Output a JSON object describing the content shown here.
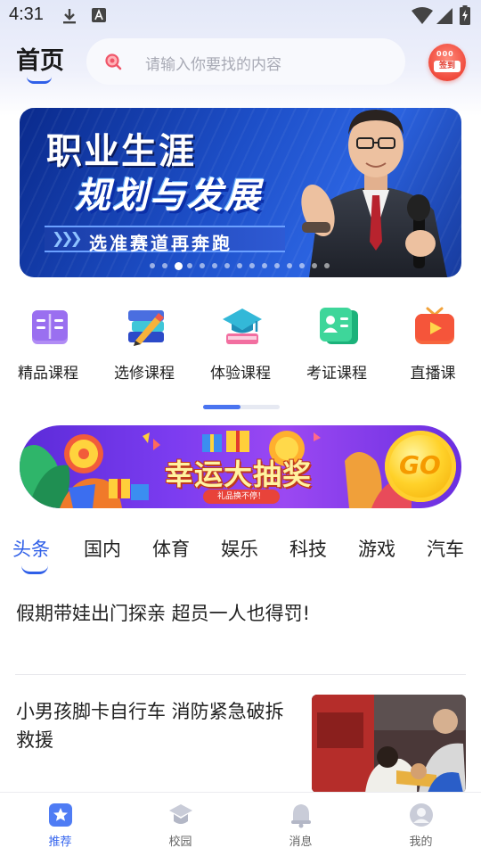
{
  "status_bar": {
    "time": "4:31"
  },
  "header": {
    "title": "首页",
    "search_placeholder": "请输入你要找的内容",
    "checkin": {
      "top_text": "000",
      "label": "签到"
    }
  },
  "banner": {
    "title_line1": "职业生涯",
    "title_line2": "规划与发展",
    "subtitle": "选准赛道再奔跑",
    "dot_count": 15,
    "active_dot": 2
  },
  "categories": [
    {
      "label": "精品课程",
      "icon": "book-open-icon"
    },
    {
      "label": "选修课程",
      "icon": "books-pencil-icon"
    },
    {
      "label": "体验课程",
      "icon": "graduation-cap-icon"
    },
    {
      "label": "考证课程",
      "icon": "id-card-icon"
    },
    {
      "label": "直播课",
      "icon": "tv-play-icon"
    }
  ],
  "promo": {
    "title": "幸运大抽奖",
    "subtitle": "礼品换不停！",
    "coin_text": "GO"
  },
  "news_tabs": [
    "头条",
    "国内",
    "体育",
    "娱乐",
    "科技",
    "游戏",
    "汽车"
  ],
  "active_news_tab": 0,
  "news": [
    {
      "title": "假期带娃出门探亲  超员一人也得罚!"
    },
    {
      "title_line1": "小男孩脚卡自行车  消防紧急破拆",
      "title_line2": "救援"
    }
  ],
  "bottom_nav": [
    {
      "label": "推荐",
      "icon": "star-icon",
      "active": true
    },
    {
      "label": "校园",
      "icon": "campus-icon",
      "active": false
    },
    {
      "label": "消息",
      "icon": "bell-icon",
      "active": false
    },
    {
      "label": "我的",
      "icon": "user-icon",
      "active": false
    }
  ],
  "colors": {
    "accent": "#2f5fe8",
    "nav_active": "#3766ee"
  }
}
